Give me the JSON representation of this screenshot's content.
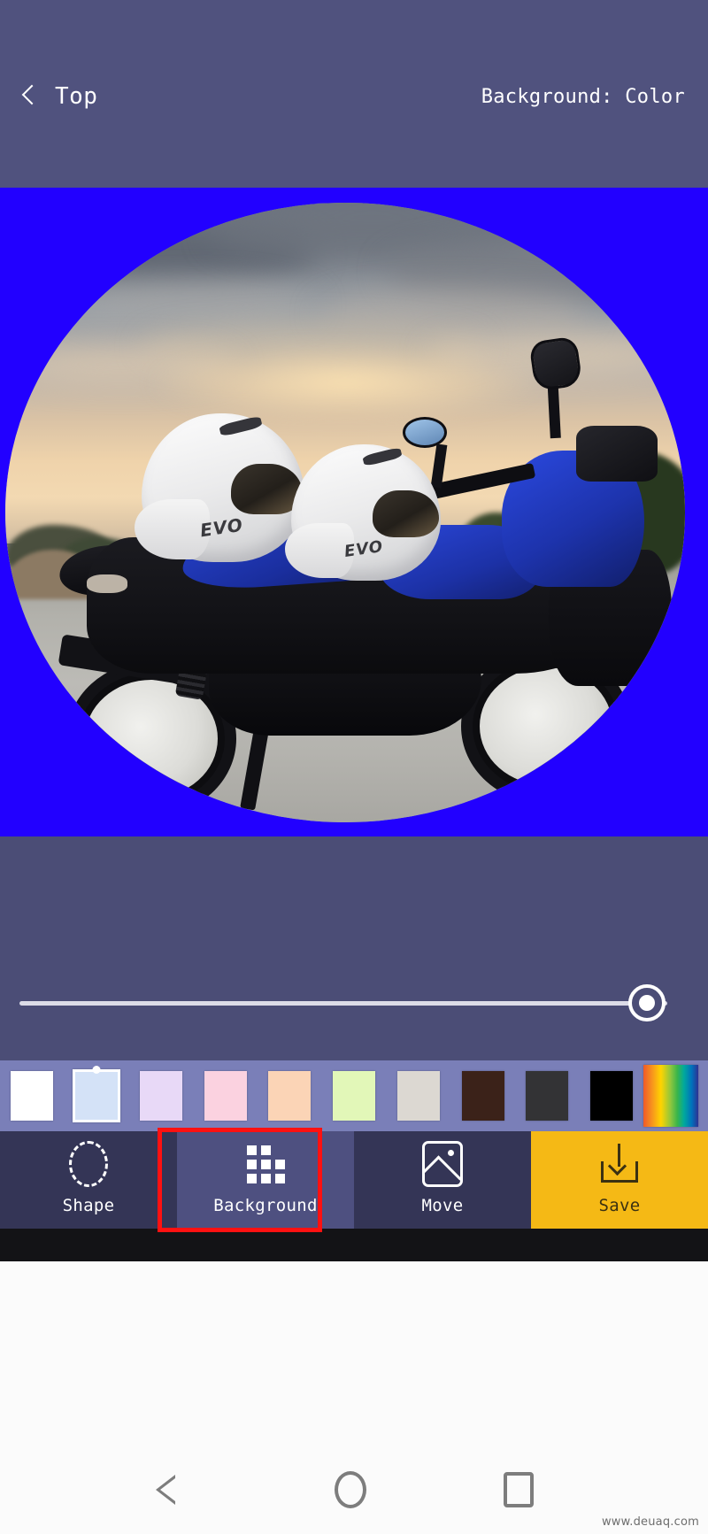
{
  "header": {
    "back_icon": "chevron-left-icon",
    "title": "Top",
    "mode_label": "Background: Color"
  },
  "canvas": {
    "background_color": "#2200ff",
    "shape": "circle",
    "photo_description": "Blue and black Yamaha motorcycle with two white EVO helmets at sunset"
  },
  "slider": {
    "name": "size-slider",
    "value_percent": 100,
    "track_color": "#dcdce8"
  },
  "palette": {
    "selected_index": 1,
    "swatches": [
      {
        "name": "swatch-white",
        "color": "#ffffff"
      },
      {
        "name": "swatch-light-blue",
        "color": "#d4e2f7"
      },
      {
        "name": "swatch-lavender",
        "color": "#e8d9f7"
      },
      {
        "name": "swatch-pink",
        "color": "#fbd2e0"
      },
      {
        "name": "swatch-peach",
        "color": "#fbd4b6"
      },
      {
        "name": "swatch-light-green",
        "color": "#e2f7b8"
      },
      {
        "name": "swatch-beige",
        "color": "#dcd8d2"
      },
      {
        "name": "swatch-dark-brown",
        "color": "#3b2219"
      },
      {
        "name": "swatch-dark-gray",
        "color": "#333335"
      },
      {
        "name": "swatch-black",
        "color": "#000000"
      },
      {
        "name": "swatch-rainbow",
        "color": "rainbow-gradient"
      }
    ]
  },
  "tabs": [
    {
      "label": "Shape",
      "icon": "dashed-circle-icon",
      "active": false
    },
    {
      "label": "Background",
      "icon": "grid-icon",
      "active": true
    },
    {
      "label": "Move",
      "icon": "photo-icon",
      "active": false
    },
    {
      "label": "Save",
      "icon": "download-icon",
      "active": false
    }
  ],
  "colors": {
    "header_bg": "#50527e",
    "panel_bg": "#4b4d76",
    "palette_bg": "#7a7fb8",
    "tabbar_bg": "#343556",
    "tab_active_bg": "#4e5080",
    "save_bg": "#f5b915",
    "annotation": "#ff1111"
  },
  "navbar": {
    "back": "back-triangle-icon",
    "home": "home-circle-icon",
    "recents": "recents-square-icon"
  },
  "watermark": "www.deuaq.com"
}
